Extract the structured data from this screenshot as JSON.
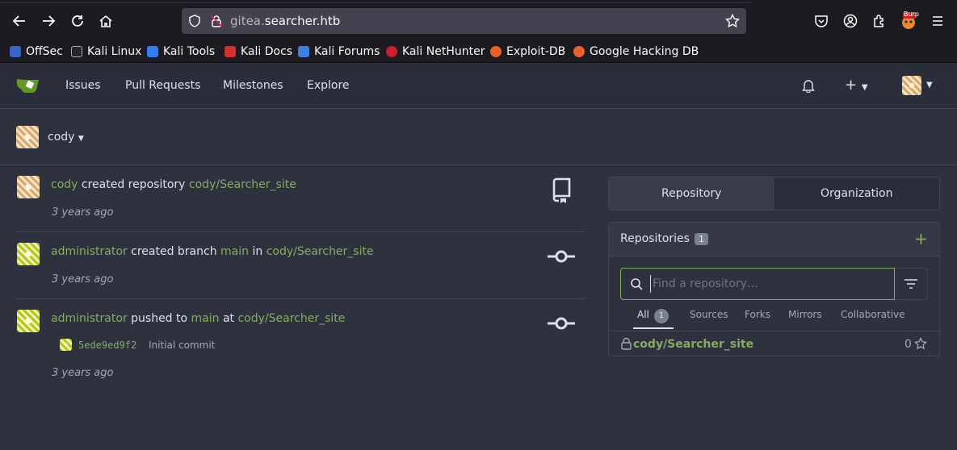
{
  "browser": {
    "url_prefix": "gitea.",
    "url_domain": "searcher.htb",
    "bookmarks": [
      "OffSec",
      "Kali Linux",
      "Kali Tools",
      "Kali Docs",
      "Kali Forums",
      "Kali NetHunter",
      "Exploit-DB",
      "Google Hacking DB"
    ],
    "burp_label": "Burp"
  },
  "navbar": {
    "items": [
      "Issues",
      "Pull Requests",
      "Milestones",
      "Explore"
    ],
    "plus": "+"
  },
  "user": {
    "name": "cody"
  },
  "feed": [
    {
      "actor": "cody",
      "action": " created repository ",
      "target": "cody/Searcher_site",
      "time": "3 years ago"
    },
    {
      "actor": "administrator",
      "action": " created branch ",
      "branch": "main",
      "in": " in ",
      "target": "cody/Searcher_site",
      "time": "3 years ago"
    },
    {
      "actor": "administrator",
      "action": " pushed to ",
      "branch": "main",
      "at": " at ",
      "target": "cody/Searcher_site",
      "commit_sha": "5ede9ed9f2",
      "commit_msg": "Initial commit",
      "time": "3 years ago"
    }
  ],
  "panel": {
    "tabs": [
      "Repository",
      "Organization"
    ],
    "title": "Repositories",
    "count": "1",
    "search_placeholder": "Find a repository…",
    "filters": [
      "All",
      "Sources",
      "Forks",
      "Mirrors",
      "Collaborative"
    ],
    "all_count": "1",
    "repo": {
      "name": "cody/Searcher_site",
      "stars": "0"
    },
    "accent": "#87ab63"
  }
}
